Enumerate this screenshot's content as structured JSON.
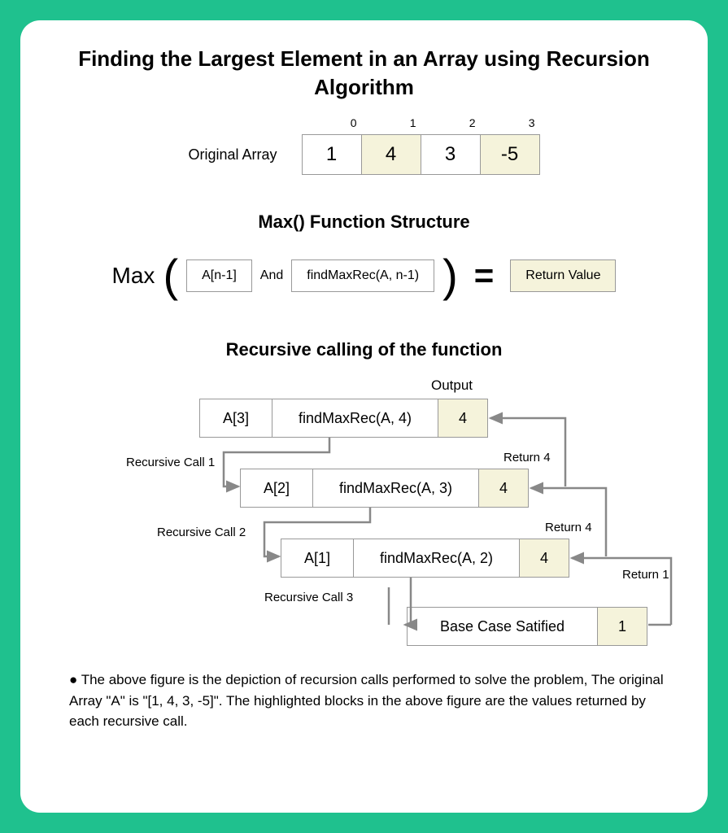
{
  "title": "Finding the Largest Element in an Array using Recursion Algorithm",
  "array": {
    "label": "Original Array",
    "indices": [
      "0",
      "1",
      "2",
      "3"
    ],
    "values": [
      "1",
      "4",
      "3",
      "-5"
    ],
    "highlighted": [
      false,
      true,
      false,
      true
    ]
  },
  "maxStructure": {
    "heading": "Max() Function Structure",
    "maxLabel": "Max",
    "arg1": "A[n-1]",
    "andLabel": "And",
    "arg2": "findMaxRec(A, n-1)",
    "equals": "=",
    "result": "Return Value"
  },
  "recursion": {
    "heading": "Recursive calling of the function",
    "outputLabel": "Output",
    "calls": [
      {
        "a": "A[3]",
        "f": "findMaxRec(A, 4)",
        "out": "4"
      },
      {
        "a": "A[2]",
        "f": "findMaxRec(A, 3)",
        "out": "4"
      },
      {
        "a": "A[1]",
        "f": "findMaxRec(A, 2)",
        "out": "4"
      }
    ],
    "base": {
      "label": "Base Case Satified",
      "out": "1"
    },
    "callLabels": [
      "Recursive Call 1",
      "Recursive Call 2",
      "Recursive Call 3"
    ],
    "returnLabels": [
      "Return 4",
      "Return 4",
      "Return 1"
    ]
  },
  "description": "The above figure is the depiction of recursion calls performed to solve the problem, The original Array \"A\" is \"[1, 4, 3, -5]\". The highlighted blocks in the above figure are the values returned by each recursive call."
}
